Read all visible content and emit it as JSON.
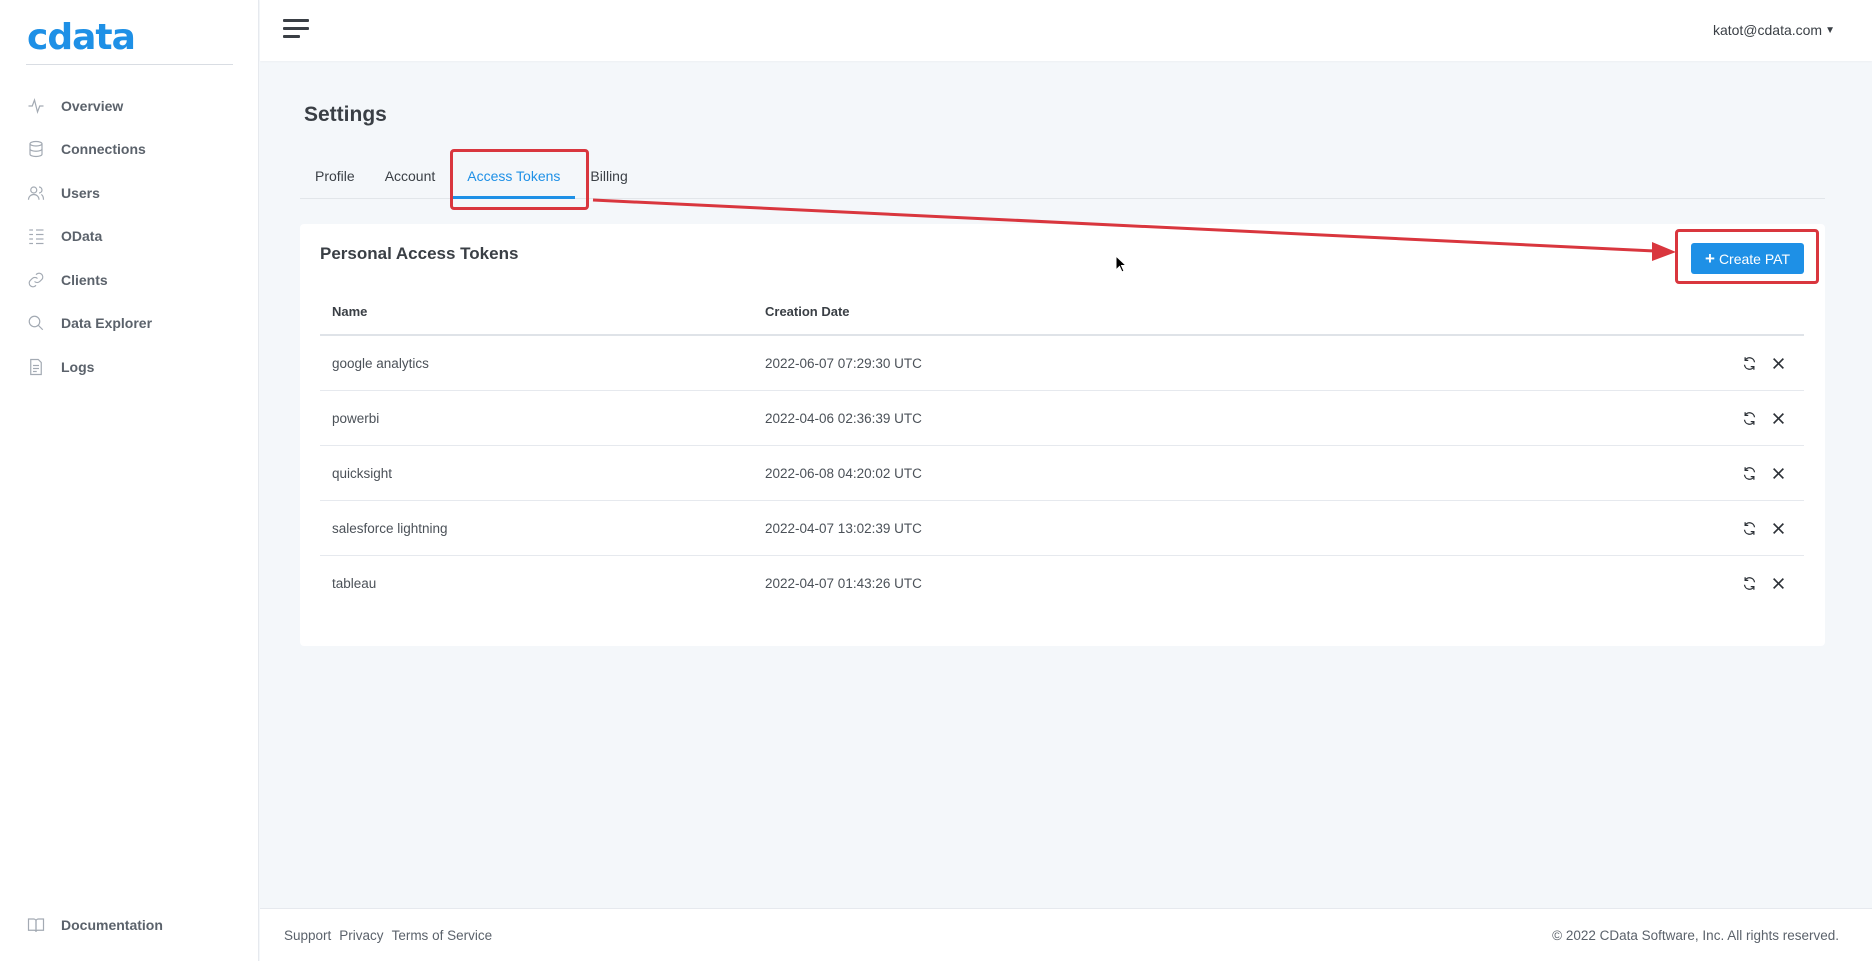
{
  "app": {
    "logo_text": "cdata"
  },
  "sidebar": {
    "items": [
      {
        "label": "Overview",
        "icon": "activity-icon"
      },
      {
        "label": "Connections",
        "icon": "database-icon"
      },
      {
        "label": "Users",
        "icon": "users-icon"
      },
      {
        "label": "OData",
        "icon": "list-icon"
      },
      {
        "label": "Clients",
        "icon": "link-icon"
      },
      {
        "label": "Data Explorer",
        "icon": "search-icon"
      },
      {
        "label": "Logs",
        "icon": "file-icon"
      }
    ],
    "bottom": {
      "label": "Documentation",
      "icon": "book-icon"
    }
  },
  "topbar": {
    "user_email": "katot@cdata.com"
  },
  "page": {
    "title": "Settings"
  },
  "tabs": [
    {
      "label": "Profile"
    },
    {
      "label": "Account"
    },
    {
      "label": "Access Tokens",
      "active": true
    },
    {
      "label": "Billing"
    }
  ],
  "card": {
    "title": "Personal Access Tokens",
    "create_button_label": "Create PAT",
    "columns": {
      "name": "Name",
      "date": "Creation Date"
    },
    "rows": [
      {
        "name": "google analytics",
        "date": "2022-06-07 07:29:30 UTC"
      },
      {
        "name": "powerbi",
        "date": "2022-04-06 02:36:39 UTC"
      },
      {
        "name": "quicksight",
        "date": "2022-06-08 04:20:02 UTC"
      },
      {
        "name": "salesforce lightning",
        "date": "2022-04-07 13:02:39 UTC"
      },
      {
        "name": "tableau",
        "date": "2022-04-07 01:43:26 UTC"
      }
    ]
  },
  "footer": {
    "links": [
      "Support",
      "Privacy",
      "Terms of Service"
    ],
    "copyright": "© 2022 CData Software, Inc. All rights reserved."
  },
  "colors": {
    "accent": "#1e90e6",
    "annotation": "#d9363e"
  }
}
